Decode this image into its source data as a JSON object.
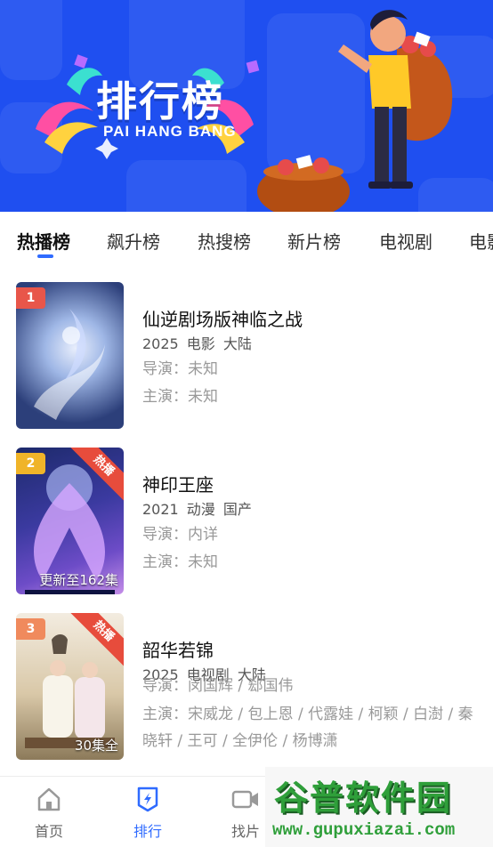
{
  "banner": {
    "title_cn": "排行榜",
    "title_en": "PAI HANG BANG"
  },
  "tabs": [
    {
      "label": "热播榜",
      "active": true
    },
    {
      "label": "飙升榜",
      "active": false
    },
    {
      "label": "热搜榜",
      "active": false
    },
    {
      "label": "新片榜",
      "active": false
    },
    {
      "label": "电视剧",
      "active": false
    },
    {
      "label": "电影",
      "active": false
    }
  ],
  "items": [
    {
      "rank": "1",
      "rank_color": "#e8564a",
      "hot_badge": "",
      "episode": "",
      "title": "仙逆剧场版神临之战",
      "meta": "2025  电影  大陆",
      "director": "导演：未知",
      "cast": "主演：未知",
      "poster_colors": [
        "#2c3f7a",
        "#9fb7e6",
        "#e8eefc"
      ]
    },
    {
      "rank": "2",
      "rank_color": "#f0b429",
      "hot_badge": "热播",
      "episode": "更新至162集",
      "title": "神印王座",
      "meta": "2021  动漫  国产",
      "director": "导演：内详",
      "cast": "主演：未知",
      "poster_colors": [
        "#1d2a6b",
        "#6d4cc7",
        "#c48de8"
      ]
    },
    {
      "rank": "3",
      "rank_color": "#f08a5d",
      "hot_badge": "热播",
      "episode": "30集全",
      "title": "韶华若锦",
      "meta": "2025  电视剧  大陆",
      "director": "导演：闵国辉 / 郄国伟",
      "cast": "主演：宋威龙 / 包上恩 / 代露娃 / 柯颖 / 白澍 / 秦晓轩 / 王可 / 全伊伦 / 杨博潇",
      "poster_colors": [
        "#d9c8a8",
        "#8c7a5a",
        "#f3ece0"
      ]
    }
  ],
  "bottom_nav": [
    {
      "label": "首页",
      "icon": "home-icon",
      "active": false
    },
    {
      "label": "排行",
      "icon": "ranking-icon",
      "active": true
    },
    {
      "label": "找片",
      "icon": "video-icon",
      "active": false
    }
  ],
  "watermark": {
    "cn": "谷普软件园",
    "url": "www.gupuxiazai.com"
  },
  "colors": {
    "banner_bg": "#1f4ff0",
    "accent": "#2f6bff",
    "hot": "#e74c3c"
  }
}
